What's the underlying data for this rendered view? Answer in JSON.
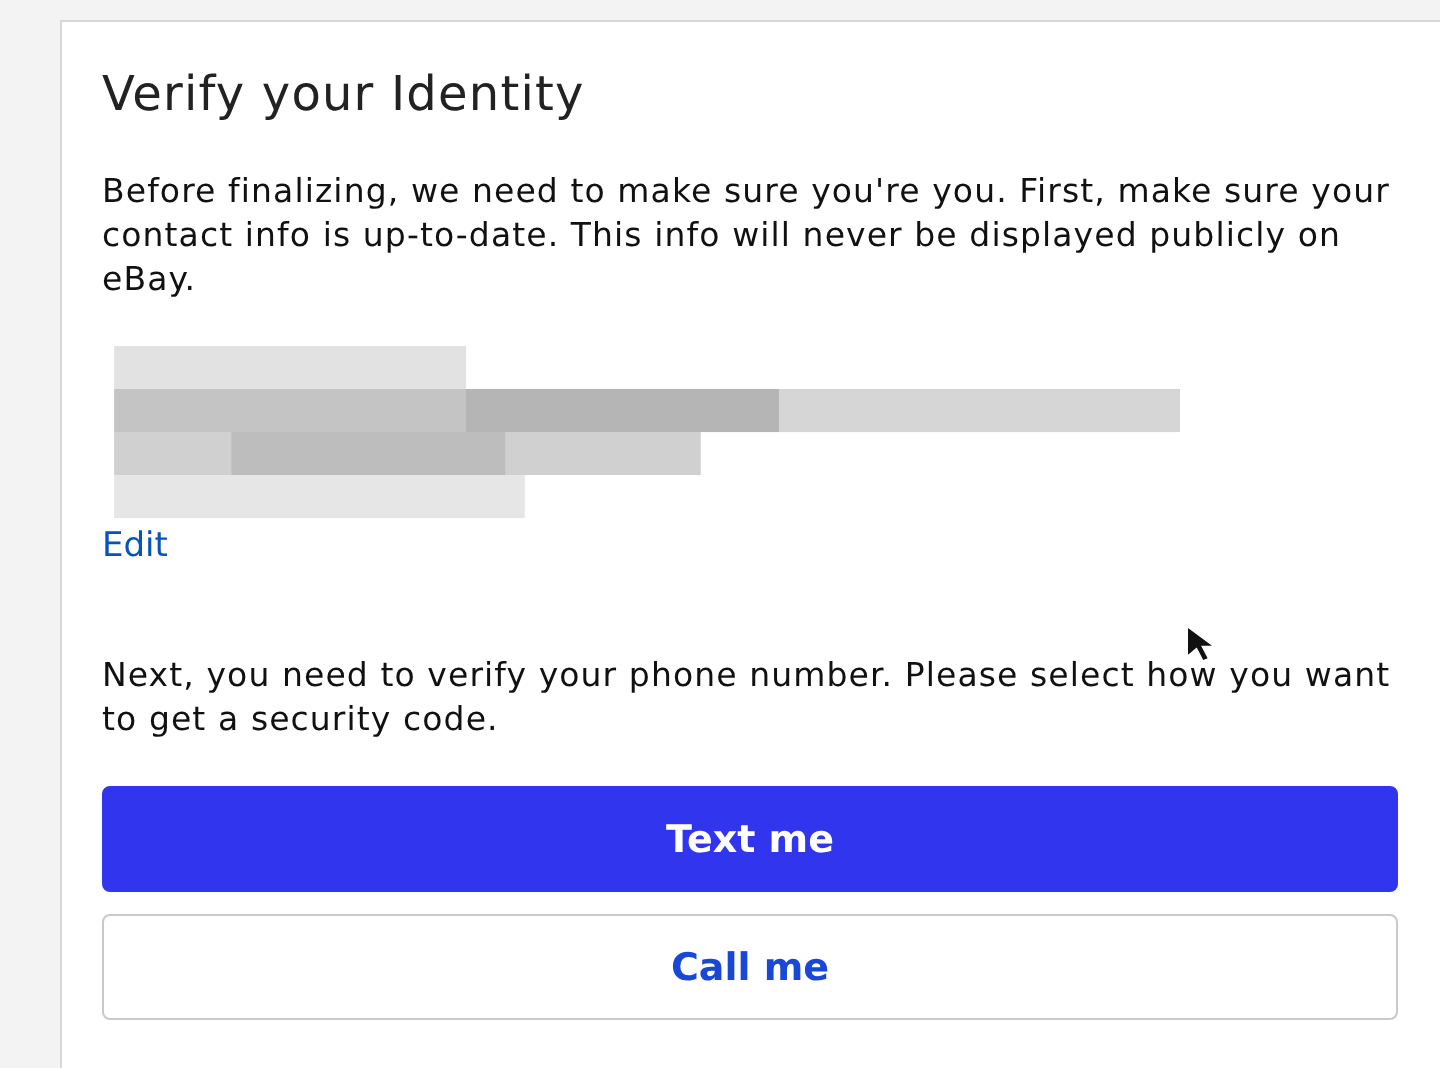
{
  "card": {
    "title": "Verify your Identity",
    "intro": "Before finalizing, we need to make sure you're you. First, make sure your contact info is up-to-date. This info will never be displayed publicly on eBay.",
    "contact": {
      "kind": "redacted"
    },
    "edit_link": "Edit",
    "instruction": "Next, you need to verify your phone number. Please select how you want to get a security code.",
    "buttons": [
      {
        "label": "Text me",
        "kind": "primary"
      },
      {
        "label": "Call me",
        "kind": "secondary"
      }
    ]
  }
}
